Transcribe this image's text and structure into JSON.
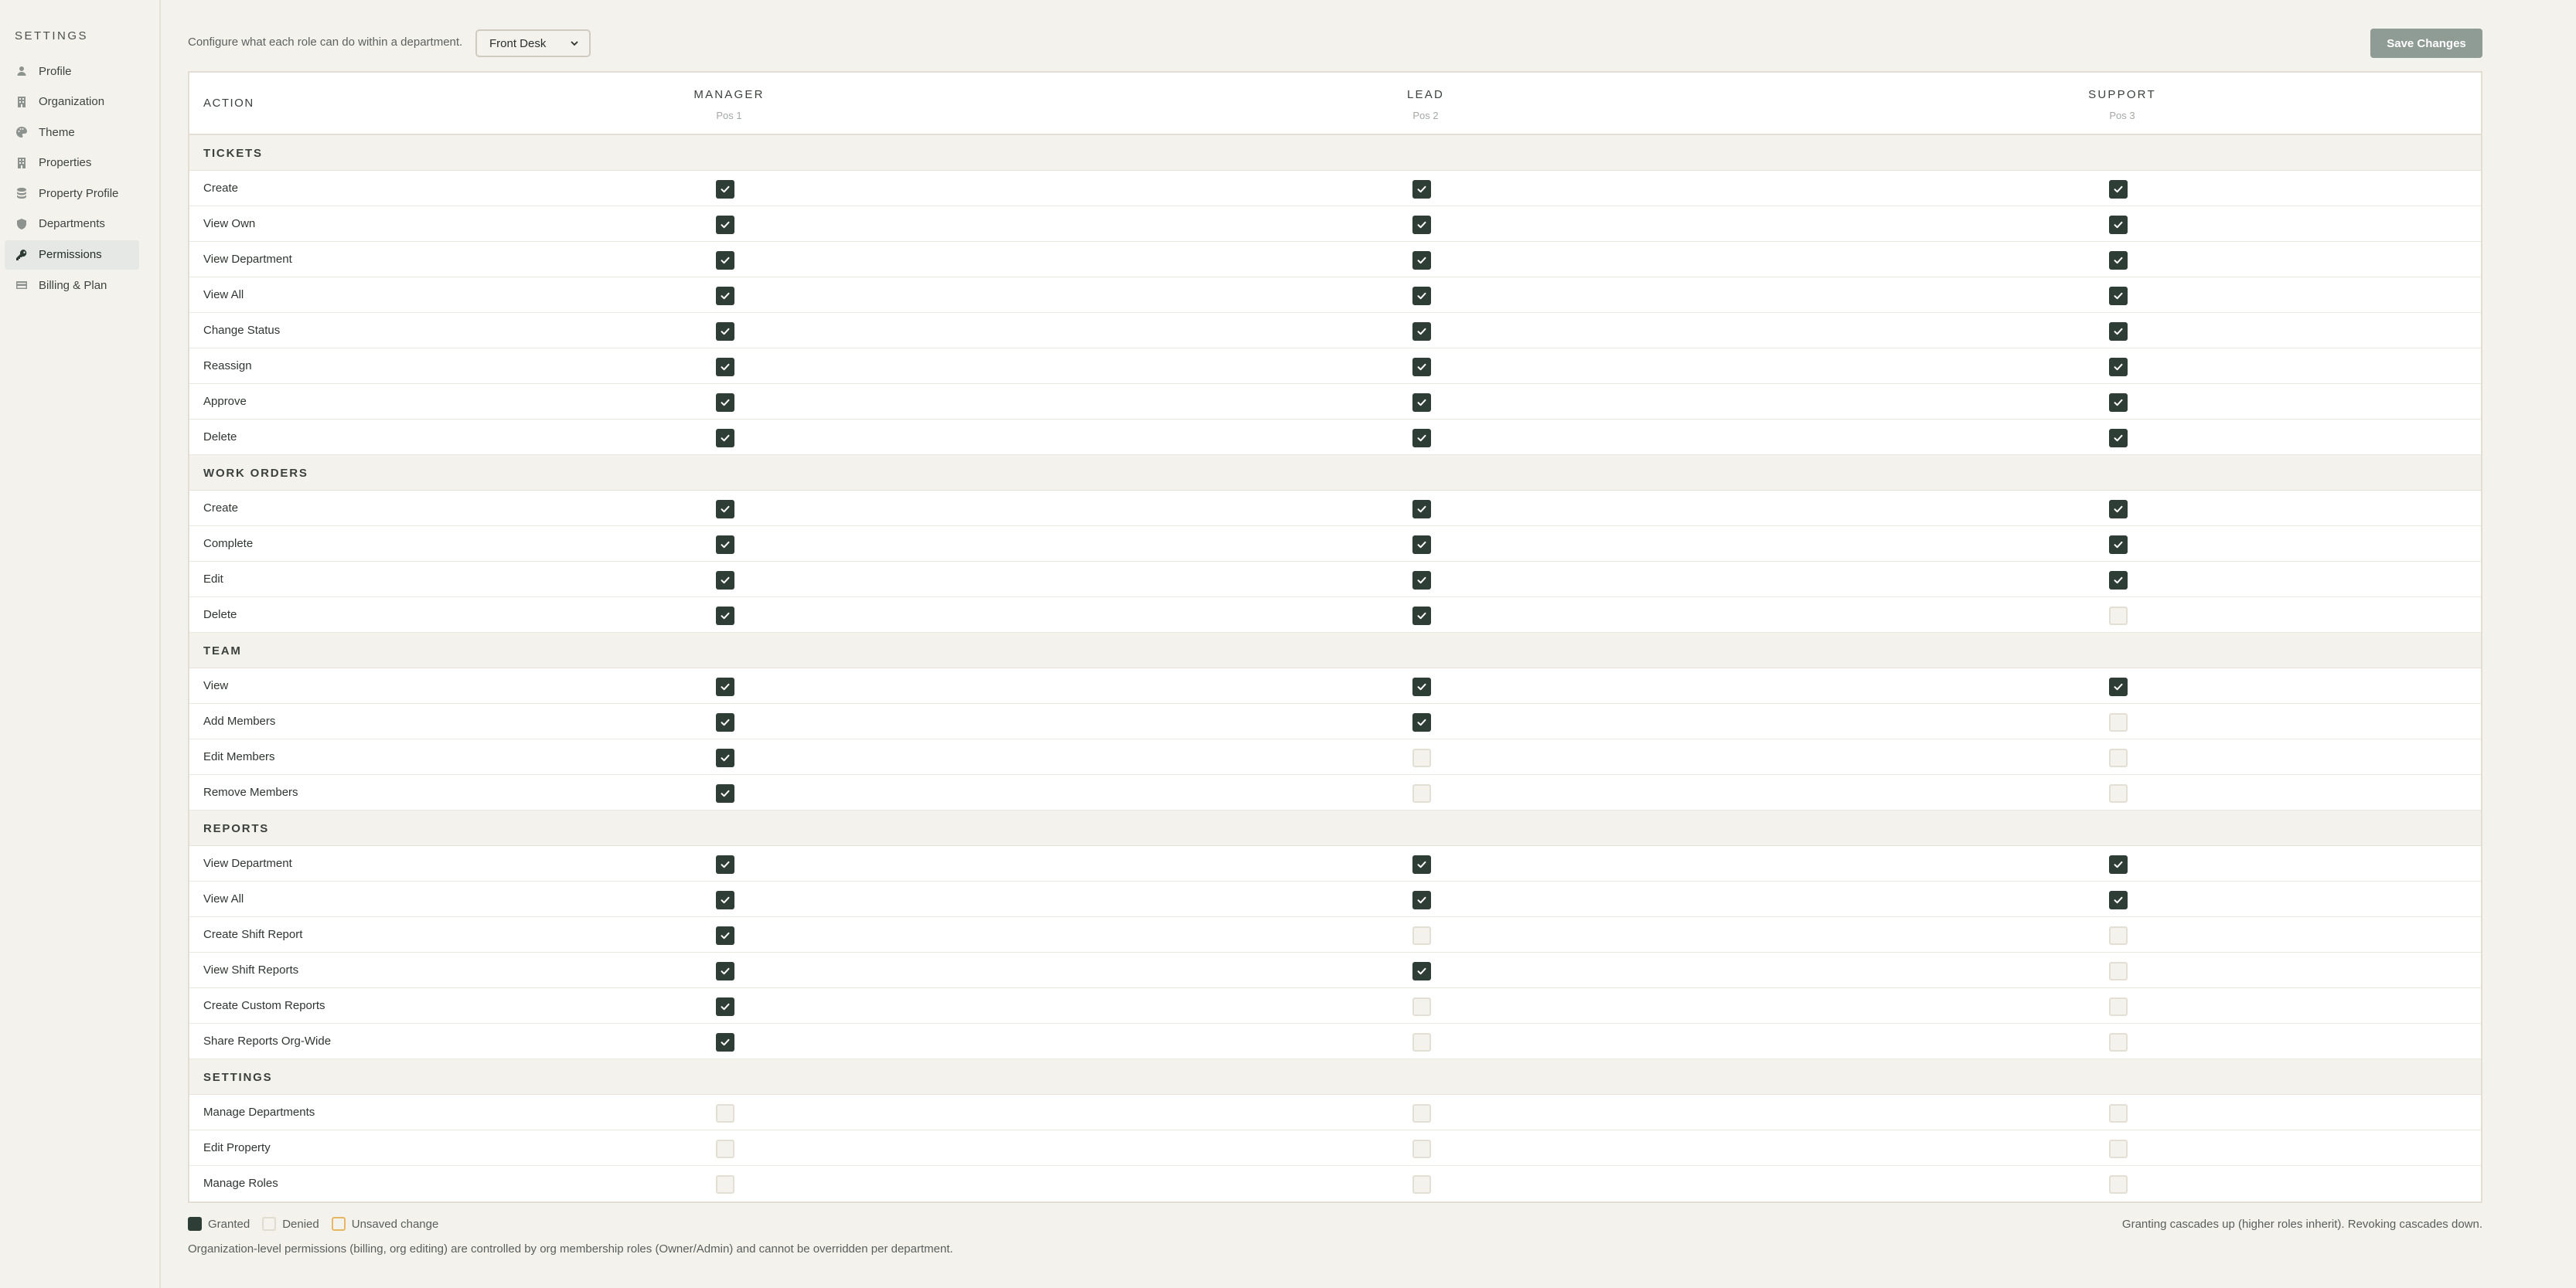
{
  "sidebar": {
    "title": "SETTINGS",
    "items": [
      {
        "label": "Profile",
        "icon": "user-icon"
      },
      {
        "label": "Organization",
        "icon": "building-icon"
      },
      {
        "label": "Theme",
        "icon": "palette-icon"
      },
      {
        "label": "Properties",
        "icon": "building-icon"
      },
      {
        "label": "Property Profile",
        "icon": "database-icon"
      },
      {
        "label": "Departments",
        "icon": "shield-icon"
      },
      {
        "label": "Permissions",
        "icon": "key-icon",
        "active": true
      },
      {
        "label": "Billing & Plan",
        "icon": "card-icon"
      }
    ]
  },
  "topbar": {
    "description": "Configure what each role can do within a department.",
    "department_select": "Front Desk",
    "save_label": "Save Changes"
  },
  "table": {
    "action_header": "ACTION",
    "roles": [
      {
        "name": "MANAGER",
        "pos": "Pos 1"
      },
      {
        "name": "LEAD",
        "pos": "Pos 2"
      },
      {
        "name": "SUPPORT",
        "pos": "Pos 3"
      }
    ],
    "sections": [
      {
        "title": "TICKETS",
        "rows": [
          {
            "label": "Create",
            "v": [
              true,
              true,
              true
            ]
          },
          {
            "label": "View Own",
            "v": [
              true,
              true,
              true
            ]
          },
          {
            "label": "View Department",
            "v": [
              true,
              true,
              true
            ]
          },
          {
            "label": "View All",
            "v": [
              true,
              true,
              true
            ]
          },
          {
            "label": "Change Status",
            "v": [
              true,
              true,
              true
            ]
          },
          {
            "label": "Reassign",
            "v": [
              true,
              true,
              true
            ]
          },
          {
            "label": "Approve",
            "v": [
              true,
              true,
              true
            ]
          },
          {
            "label": "Delete",
            "v": [
              true,
              true,
              true
            ]
          }
        ]
      },
      {
        "title": "WORK ORDERS",
        "rows": [
          {
            "label": "Create",
            "v": [
              true,
              true,
              true
            ]
          },
          {
            "label": "Complete",
            "v": [
              true,
              true,
              true
            ]
          },
          {
            "label": "Edit",
            "v": [
              true,
              true,
              true
            ]
          },
          {
            "label": "Delete",
            "v": [
              true,
              true,
              false
            ]
          }
        ]
      },
      {
        "title": "TEAM",
        "rows": [
          {
            "label": "View",
            "v": [
              true,
              true,
              true
            ]
          },
          {
            "label": "Add Members",
            "v": [
              true,
              true,
              false
            ]
          },
          {
            "label": "Edit Members",
            "v": [
              true,
              false,
              false
            ]
          },
          {
            "label": "Remove Members",
            "v": [
              true,
              false,
              false
            ]
          }
        ]
      },
      {
        "title": "REPORTS",
        "rows": [
          {
            "label": "View Department",
            "v": [
              true,
              true,
              true
            ]
          },
          {
            "label": "View All",
            "v": [
              true,
              true,
              true
            ]
          },
          {
            "label": "Create Shift Report",
            "v": [
              true,
              false,
              false
            ]
          },
          {
            "label": "View Shift Reports",
            "v": [
              true,
              true,
              false
            ]
          },
          {
            "label": "Create Custom Reports",
            "v": [
              true,
              false,
              false
            ]
          },
          {
            "label": "Share Reports Org-Wide",
            "v": [
              true,
              false,
              false
            ]
          }
        ]
      },
      {
        "title": "SETTINGS",
        "rows": [
          {
            "label": "Manage Departments",
            "v": [
              false,
              false,
              false
            ]
          },
          {
            "label": "Edit Property",
            "v": [
              false,
              false,
              false
            ]
          },
          {
            "label": "Manage Roles",
            "v": [
              false,
              false,
              false
            ]
          }
        ]
      }
    ]
  },
  "legend": {
    "granted": "Granted",
    "denied": "Denied",
    "unsaved": "Unsaved change",
    "cascade_note": "Granting cascades up (higher roles inherit). Revoking cascades down."
  },
  "footer_note": "Organization-level permissions (billing, org editing) are controlled by org membership roles (Owner/Admin) and cannot be overridden per department.",
  "colors": {
    "accent": "#2e3e36",
    "save_button": "#8f9c95",
    "background": "#f4f2ec",
    "unsaved": "#e8b766"
  }
}
